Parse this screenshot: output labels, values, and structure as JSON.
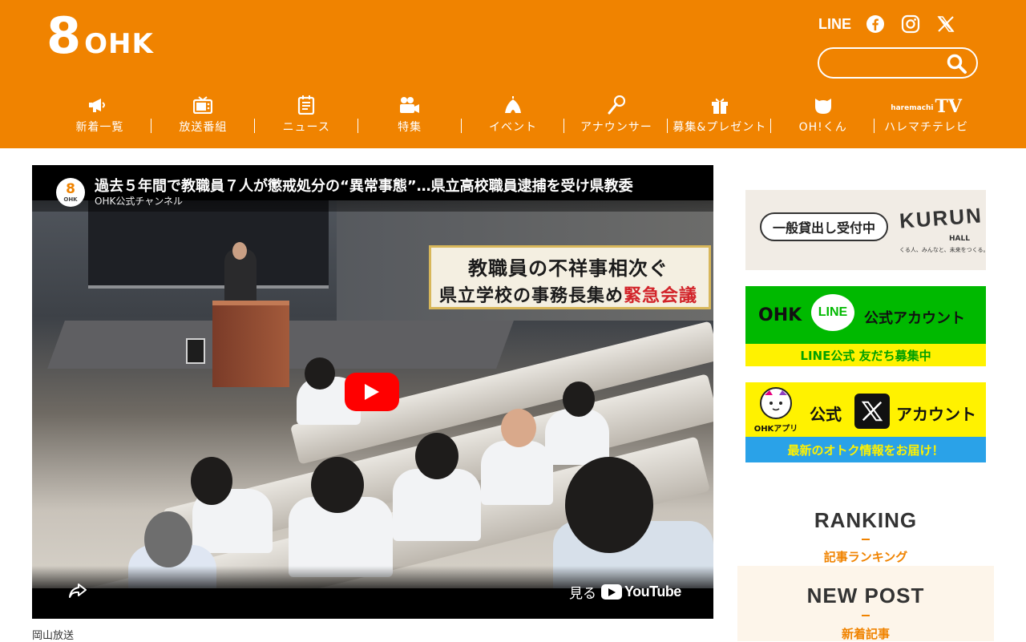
{
  "brand": {
    "logo_number": "8",
    "logo_text": "OHK"
  },
  "social": {
    "line_label": "LINE"
  },
  "search": {
    "placeholder": ""
  },
  "nav": [
    {
      "label": "新着一覧",
      "icon": "megaphone-icon"
    },
    {
      "label": "放送番組",
      "icon": "tv-icon"
    },
    {
      "label": "ニュース",
      "icon": "newspaper-icon"
    },
    {
      "label": "特集",
      "icon": "video-camera-icon"
    },
    {
      "label": "イベント",
      "icon": "tent-icon"
    },
    {
      "label": "アナウンサー",
      "icon": "microphone-icon"
    },
    {
      "label": "募集&プレゼント",
      "icon": "gift-icon"
    },
    {
      "label": "OH!くん",
      "icon": "mascot-icon"
    },
    {
      "label": "ハレマチテレビ",
      "icon_small": "haremachi",
      "icon_big": "TV"
    }
  ],
  "video": {
    "title": "過去５年間で教職員７人が懲戒処分の“異常事態”…県立高校職員逮捕を受け県教委",
    "channel": "OHK公式チャンネル",
    "channel_icon_number": "8",
    "channel_icon_text": "OHK",
    "caption_line1": "教職員の不祥事相次ぐ",
    "caption_line2_prefix": "県立学校の事務長集め",
    "caption_line2_highlight": "緊急会議",
    "watch_on": "見る",
    "youtube": "YouTube"
  },
  "article": {
    "source": "岡山放送"
  },
  "sidebar": {
    "kurun": {
      "tag": "一般貸出し受付中",
      "name": "KURUN",
      "hall": "HALL",
      "sub": "くる人、みんなと、未来をつくる。"
    },
    "line": {
      "ohk": "OHK",
      "line": "LINE",
      "account": "公式アカウント",
      "strip": "LINE公式 友だち募集中"
    },
    "x": {
      "app": "OHKアプリ",
      "official": "公式",
      "account": "アカウント",
      "strip": "最新のオトク情報をお届け！"
    },
    "ranking": {
      "title": "RANKING",
      "sub": "記事ランキング"
    },
    "newpost": {
      "title": "NEW POST",
      "sub": "新着記事"
    }
  },
  "colors": {
    "brand_orange": "#f08300",
    "line_green": "#00b900",
    "yellow": "#fff200",
    "youtube_red": "#ff0000"
  }
}
